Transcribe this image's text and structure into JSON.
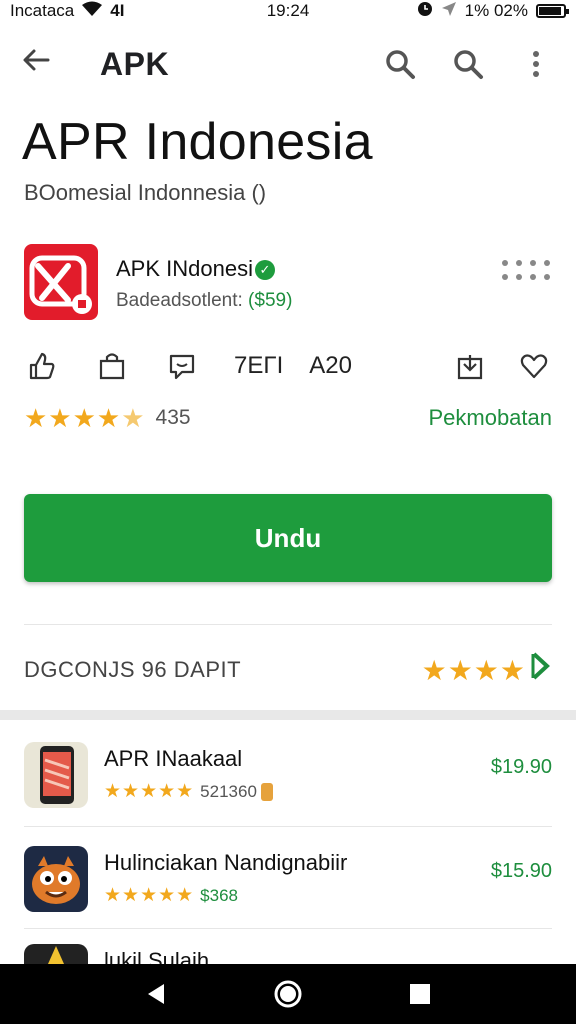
{
  "status_bar": {
    "carrier": "Incataca",
    "signal_text": "4I",
    "time": "19:24",
    "battery_text": "1% 02%"
  },
  "app_bar": {
    "title": "APK"
  },
  "page": {
    "title": "APR Indonesia",
    "subtitle": "BOomesial Indonnesia ()"
  },
  "app": {
    "name": "APK INdonesi",
    "developer": "Badeadsotlent:",
    "price": "($59)"
  },
  "actions": {
    "text1": "7EΓI",
    "text2": "A20"
  },
  "rating": {
    "stars": "★★★★",
    "half_star": "★",
    "count": "435",
    "recommend_label": "Pekmobatan"
  },
  "install_label": "Undu",
  "reviews": {
    "label": "DGCONJS 96 DAPIT",
    "stars": "★★★★"
  },
  "related": [
    {
      "name": "APR INaakaal",
      "stars": "★★★★★",
      "count": "521360",
      "price": "$19.90"
    },
    {
      "name": "Hulinciakan Nandignabiir",
      "stars": "★★★★★",
      "count": "$368",
      "price": "$15.90"
    },
    {
      "name": "lukil Sulaih"
    }
  ],
  "colors": {
    "accent_green": "#1e9c3d",
    "star": "#f2a81d",
    "app_icon_red": "#e21c2b"
  }
}
